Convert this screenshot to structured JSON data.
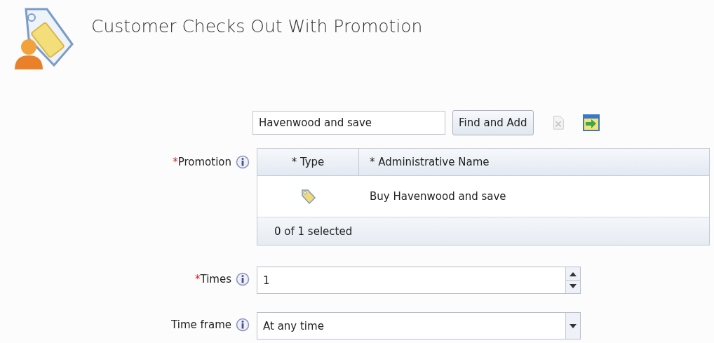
{
  "title": "Customer Checks Out With Promotion",
  "search": {
    "value": "Havenwood and save",
    "button": "Find and Add"
  },
  "promotion": {
    "mark": "*",
    "label": "Promotion",
    "columns": [
      "* Type",
      "* Administrative Name"
    ],
    "rows": [
      {
        "name": "Buy Havenwood and save",
        "selected": false
      }
    ],
    "footer": "0 of 1 selected"
  },
  "times": {
    "mark": "*",
    "label": "Times",
    "value": "1"
  },
  "time_frame": {
    "label": "Time frame",
    "value": "At any time"
  }
}
